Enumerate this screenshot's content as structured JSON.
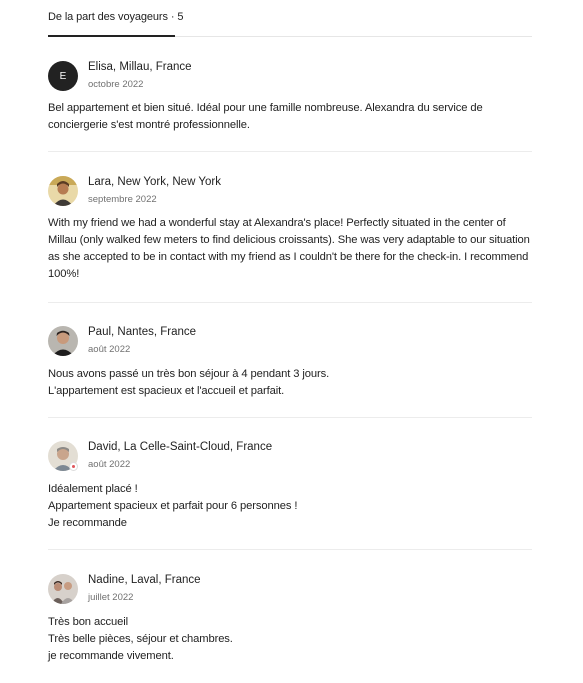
{
  "header": {
    "tab_label": "De la part des voyageurs · 5"
  },
  "reviews": [
    {
      "initial": "E",
      "name": "Elisa, Millau, France",
      "date": "octobre 2022",
      "text": "Bel appartement et bien situé. Idéal pour une famille nombreuse. Alexandra du service de conciergerie s'est montré professionnelle."
    },
    {
      "name": "Lara, New York, New York",
      "date": "septembre 2022",
      "text": "With my friend we had a wonderful stay at Alexandra's place! Perfectly situated in the center of Millau (only walked few meters to find delicious croissants). She was very adaptable to our situation as she accepted to be in contact with my friend as I couldn't be there for the check-in. I recommend 100%!"
    },
    {
      "name": "Paul, Nantes, France",
      "date": "août 2022",
      "text": "Nous avons passé un très bon séjour à 4 pendant 3 jours.\nL'appartement est spacieux et l'accueil et parfait."
    },
    {
      "name": "David, La Celle-Saint-Cloud, France",
      "date": "août 2022",
      "text": "Idéalement placé !\nAppartement spacieux et parfait pour 6 personnes !\nJe recommande"
    },
    {
      "name": "Nadine, Laval, France",
      "date": "juillet 2022",
      "text": "Très bon accueil\nTrès belle pièces, séjour et chambres.\nje recommande vivement."
    }
  ]
}
